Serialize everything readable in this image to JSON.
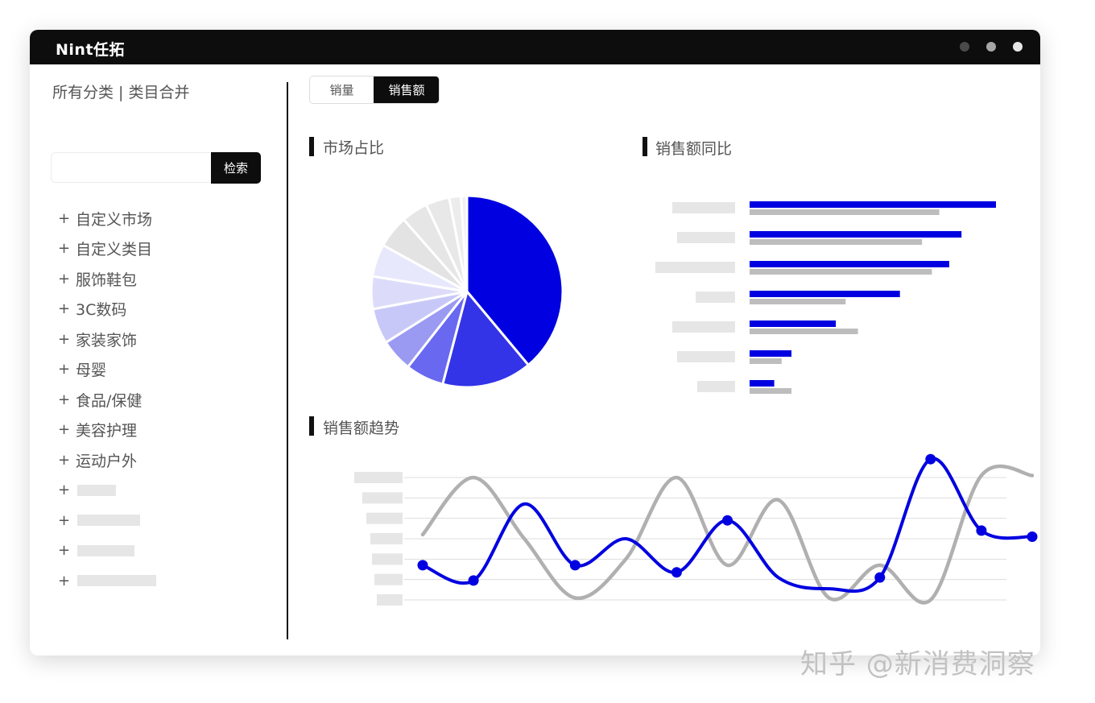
{
  "window": {
    "logo_text": "Nint任拓",
    "control_dot_colors": [
      "#4a4a4a",
      "#a6a6a6",
      "#e6e6e6"
    ]
  },
  "sidebar": {
    "title": "所有分类 | 类目合并",
    "search": {
      "value": "",
      "placeholder": "",
      "button_label": "检索"
    },
    "items": [
      {
        "icon": "+",
        "label": "自定义市场"
      },
      {
        "icon": "+",
        "label": "自定义类目"
      },
      {
        "icon": "+",
        "label": "服饰鞋包"
      },
      {
        "icon": "+",
        "label": "3C数码"
      },
      {
        "icon": "+",
        "label": "家装家饰"
      },
      {
        "icon": "+",
        "label": "母婴"
      },
      {
        "icon": "+",
        "label": "食品/保健"
      },
      {
        "icon": "+",
        "label": "美容护理"
      },
      {
        "icon": "+",
        "label": "运动户外"
      },
      {
        "icon": "+",
        "label": ""
      },
      {
        "icon": "+",
        "label": ""
      },
      {
        "icon": "+",
        "label": ""
      },
      {
        "icon": "+",
        "label": ""
      }
    ]
  },
  "tabs": [
    {
      "label": "销量",
      "active": false
    },
    {
      "label": "销售额",
      "active": true
    }
  ],
  "sections": {
    "market_share": "市场占比",
    "yoy": "销售额同比",
    "trend": "销售额趋势"
  },
  "colors": {
    "accent": "#0000e0",
    "compare_gray": "#bdbdbd",
    "placeholder": "#e6e6e6",
    "titlebar": "#0d0d0d"
  },
  "chart_data": [
    {
      "type": "pie",
      "title": "市场占比",
      "slices": [
        {
          "value": 39.0,
          "color": "#0000e0"
        },
        {
          "value": 15.2,
          "color": "#3333e8"
        },
        {
          "value": 6.5,
          "color": "#6868f0"
        },
        {
          "value": 5.5,
          "color": "#9a9af3"
        },
        {
          "value": 6.0,
          "color": "#c8c8f8"
        },
        {
          "value": 5.5,
          "color": "#dcdcfa"
        },
        {
          "value": 5.5,
          "color": "#e8e8fc"
        },
        {
          "value": 5.5,
          "color": "#e3e3e3"
        },
        {
          "value": 4.5,
          "color": "#e6e6e6"
        },
        {
          "value": 4.0,
          "color": "#e8e8e8"
        },
        {
          "value": 2.0,
          "color": "#ececec"
        },
        {
          "value": 1.0,
          "color": "#f1f1f1"
        }
      ]
    },
    {
      "type": "bar",
      "title": "销售额同比",
      "orientation": "horizontal",
      "categories": [
        "",
        "",
        "",
        "",
        "",
        "",
        ""
      ],
      "series": [
        {
          "color": "#0000e0",
          "values": [
            100,
            86,
            81,
            61,
            35,
            17,
            10
          ]
        },
        {
          "color": "#bdbdbd",
          "values": [
            77,
            70,
            74,
            39,
            44,
            13,
            17
          ]
        }
      ],
      "xlim": [
        0,
        100
      ],
      "grid": false,
      "legend": "none"
    },
    {
      "type": "line",
      "title": "销售额趋势",
      "x": [
        0,
        1,
        2,
        3,
        4,
        5,
        6,
        7,
        8,
        9,
        10,
        11,
        12
      ],
      "ylim": [
        0,
        6
      ],
      "grid": true,
      "legend": "none",
      "series": [
        {
          "color": "#0000e0",
          "markers": [
            true,
            true,
            false,
            true,
            false,
            true,
            true,
            false,
            false,
            true,
            true,
            true,
            true
          ],
          "values": [
            1.7,
            0.95,
            4.7,
            1.7,
            3.0,
            1.35,
            3.9,
            1.1,
            0.55,
            1.1,
            6.9,
            3.4,
            3.1
          ]
        },
        {
          "color": "#b0b0b0",
          "markers": [
            false,
            false,
            false,
            false,
            false,
            false,
            false,
            false,
            false,
            false,
            false,
            false,
            false
          ],
          "values": [
            3.2,
            6.0,
            3.0,
            0.1,
            2.0,
            6.0,
            1.7,
            4.9,
            0.1,
            1.7,
            0.0,
            6.1,
            6.1
          ]
        }
      ]
    }
  ],
  "watermark": "知乎 @新消费洞察"
}
